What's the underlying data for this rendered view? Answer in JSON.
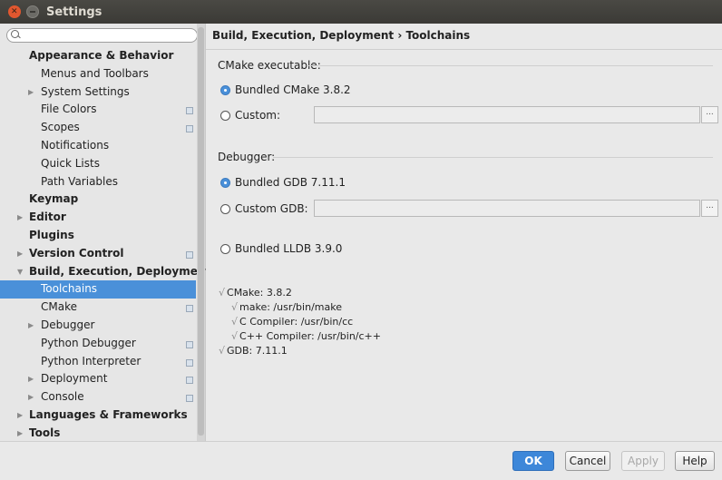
{
  "window": {
    "title": "Settings"
  },
  "search": {
    "placeholder": ""
  },
  "sidebar": {
    "items": [
      {
        "label": "Appearance & Behavior",
        "level": 0,
        "bold": true,
        "arrow": "",
        "dup": false
      },
      {
        "label": "Menus and Toolbars",
        "level": 1,
        "bold": false,
        "arrow": "",
        "dup": false
      },
      {
        "label": "System Settings",
        "level": 1,
        "bold": false,
        "arrow": "▶",
        "dup": false
      },
      {
        "label": "File Colors",
        "level": 1,
        "bold": false,
        "arrow": "",
        "dup": true
      },
      {
        "label": "Scopes",
        "level": 1,
        "bold": false,
        "arrow": "",
        "dup": true
      },
      {
        "label": "Notifications",
        "level": 1,
        "bold": false,
        "arrow": "",
        "dup": false
      },
      {
        "label": "Quick Lists",
        "level": 1,
        "bold": false,
        "arrow": "",
        "dup": false
      },
      {
        "label": "Path Variables",
        "level": 1,
        "bold": false,
        "arrow": "",
        "dup": false
      },
      {
        "label": "Keymap",
        "level": 0,
        "bold": true,
        "arrow": "",
        "dup": false
      },
      {
        "label": "Editor",
        "level": 0,
        "bold": true,
        "arrow": "▶",
        "dup": false
      },
      {
        "label": "Plugins",
        "level": 0,
        "bold": true,
        "arrow": "",
        "dup": false
      },
      {
        "label": "Version Control",
        "level": 0,
        "bold": true,
        "arrow": "▶",
        "dup": true
      },
      {
        "label": "Build, Execution, Deployment",
        "level": 0,
        "bold": true,
        "arrow": "▼",
        "dup": false
      },
      {
        "label": "Toolchains",
        "level": 1,
        "bold": false,
        "arrow": "",
        "dup": false,
        "selected": true
      },
      {
        "label": "CMake",
        "level": 1,
        "bold": false,
        "arrow": "",
        "dup": true
      },
      {
        "label": "Debugger",
        "level": 1,
        "bold": false,
        "arrow": "▶",
        "dup": false
      },
      {
        "label": "Python Debugger",
        "level": 1,
        "bold": false,
        "arrow": "",
        "dup": true
      },
      {
        "label": "Python Interpreter",
        "level": 1,
        "bold": false,
        "arrow": "",
        "dup": true
      },
      {
        "label": "Deployment",
        "level": 1,
        "bold": false,
        "arrow": "▶",
        "dup": true
      },
      {
        "label": "Console",
        "level": 1,
        "bold": false,
        "arrow": "▶",
        "dup": true
      },
      {
        "label": "Languages & Frameworks",
        "level": 0,
        "bold": true,
        "arrow": "▶",
        "dup": false
      },
      {
        "label": "Tools",
        "level": 0,
        "bold": true,
        "arrow": "▶",
        "dup": false
      }
    ]
  },
  "main": {
    "breadcrumb": "Build, Execution, Deployment › Toolchains",
    "cmake": {
      "section": "CMake executable:",
      "bundled_label": "Bundled CMake 3.8.2",
      "bundled_selected": true,
      "custom_label": "Custom:",
      "custom_value": "",
      "browse_label": "..."
    },
    "debugger": {
      "section": "Debugger:",
      "bundled_gdb_label": "Bundled GDB 7.11.1",
      "bundled_gdb_selected": true,
      "custom_gdb_label": "Custom GDB:",
      "custom_gdb_value": "",
      "browse_label": "...",
      "lldb_label": "Bundled LLDB 3.9.0"
    },
    "status": {
      "check": "√",
      "lines": [
        "CMake: 3.8.2",
        "make: /usr/bin/make",
        "C Compiler: /usr/bin/cc",
        "C++ Compiler: /usr/bin/c++",
        "GDB: 7.11.1"
      ]
    }
  },
  "buttons": {
    "ok": "OK",
    "cancel": "Cancel",
    "apply": "Apply",
    "help": "Help"
  },
  "colors": {
    "selection": "#4a90d9",
    "titlebar": "#3b3a36",
    "primary_button": "#3d87d9"
  }
}
